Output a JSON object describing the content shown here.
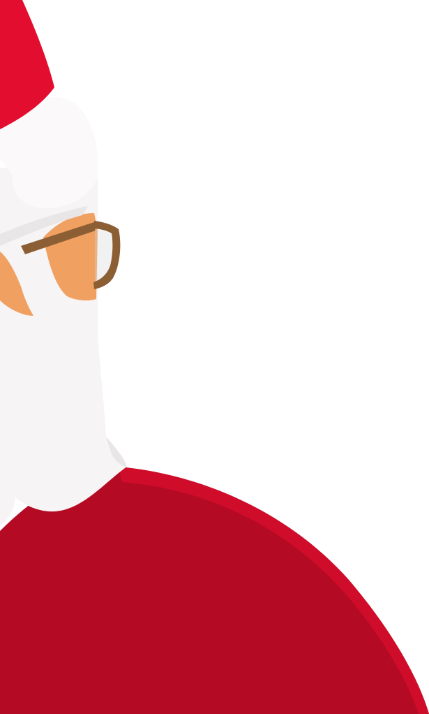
{
  "scene": {
    "subject": "santa-claus-illustration",
    "background_color": "#ffffff"
  },
  "palette": {
    "coat_red": "#b50a24",
    "coat_red_highlight": "#cf0d2a",
    "hat_red": "#e30d2f",
    "beard_white": "#f6f4f4",
    "beard_shadow": "#e9e6e7",
    "fur_white": "#fbf9f9",
    "skin": "#f0a060",
    "glasses_brown": "#8b5e34",
    "lens_grey": "#d8d8d8"
  }
}
